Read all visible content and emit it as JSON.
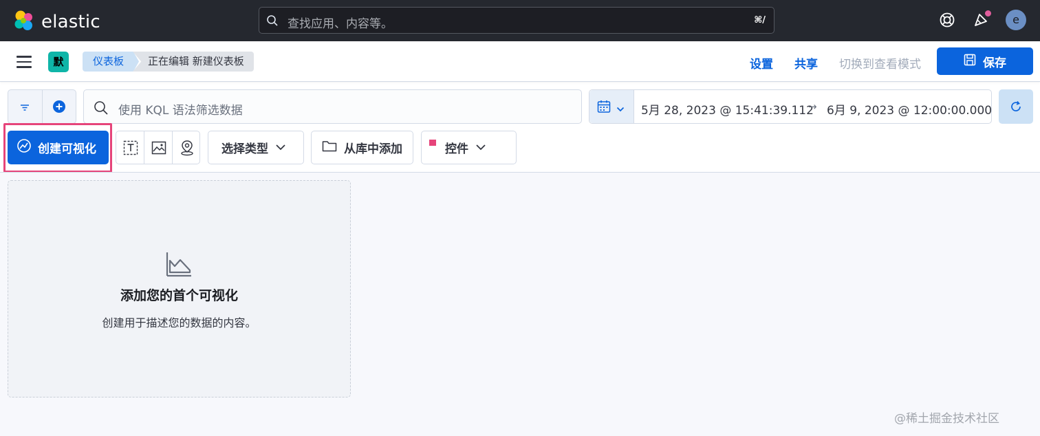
{
  "header": {
    "brand": "elastic",
    "search_placeholder": "查找应用、内容等。",
    "search_shortcut": "⌘/",
    "avatar_initial": "e",
    "icons": [
      "elastic-logo-icon",
      "search-icon",
      "help-icon",
      "news-icon"
    ],
    "accent_colors": {
      "news_dot": "#e05d9c",
      "avatar": "#6b8fc4"
    }
  },
  "nav": {
    "space_initial": "默",
    "breadcrumbs": [
      "仪表板",
      "正在编辑 新建仪表板"
    ],
    "settings_label": "设置",
    "share_label": "共享",
    "view_mode_label": "切换到查看模式",
    "save_label": "保存"
  },
  "query": {
    "kql_placeholder": "使用 KQL 语法筛选数据",
    "date_start": "5月 28, 2023 @ 15:41:39.112",
    "date_arrow": "→",
    "date_end": "6月 9, 2023 @ 12:00:00.000"
  },
  "toolbar": {
    "create_viz_label": "创建可视化",
    "select_type_label": "选择类型",
    "add_from_library_label": "从库中添加",
    "controls_label": "控件"
  },
  "empty_state": {
    "title": "添加您的首个可视化",
    "description": "创建用于描述您的数据的内容。"
  },
  "watermark": "@稀土掘金技术社区",
  "colors": {
    "primary": "#0b64dd",
    "header_bg": "#25282f",
    "highlight": "#e6447a",
    "space_badge": "#0fb5a8"
  }
}
